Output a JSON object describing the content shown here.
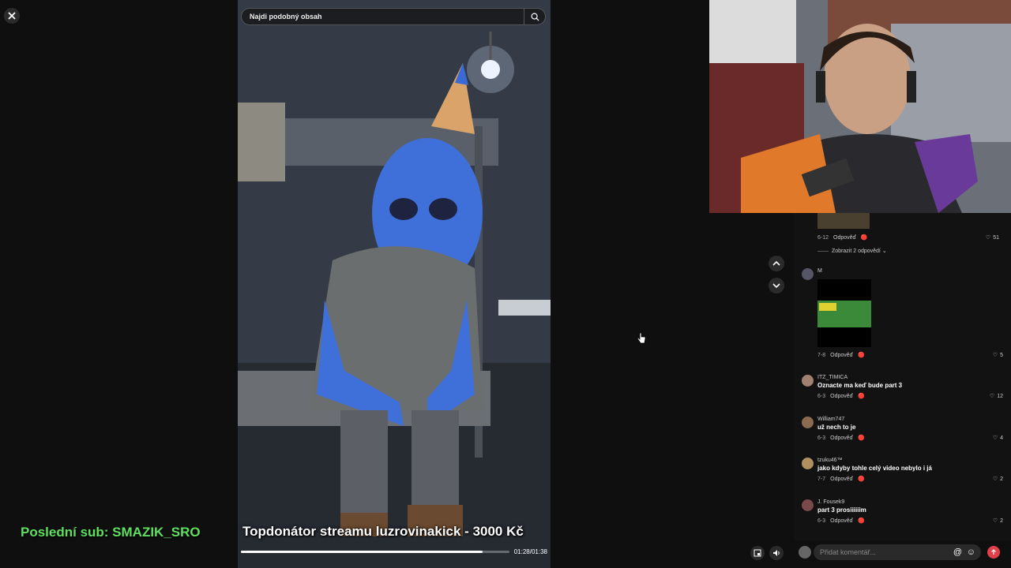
{
  "search": {
    "placeholder": "Najdi podobný obsah"
  },
  "video": {
    "caption": "Topdonátor streamu luzrovinakick - 3000 Kč",
    "time": "01:28/01:38",
    "progress": 0.9
  },
  "overlay": {
    "last_sub": "Poslední sub: SMAZIK_SRO"
  },
  "comments": {
    "top": {
      "date": "6-12",
      "reply": "Odpověď",
      "likes": "51",
      "show_replies": "Zobrazit 2 odpovědí"
    },
    "items": [
      {
        "name": "M",
        "text": "",
        "date": "7-8",
        "reply": "Odpověď",
        "likes": "5"
      },
      {
        "name": "ITZ_TIMICA",
        "text": "Oznacte ma keď bude part 3",
        "date": "6-3",
        "reply": "Odpověď",
        "likes": "12"
      },
      {
        "name": "William747",
        "text": "už nech to je",
        "date": "6-3",
        "reply": "Odpověď",
        "likes": "4"
      },
      {
        "name": "tzuku46™",
        "text": "jako kdyby tohle celý video nebylo i já",
        "date": "7-7",
        "reply": "Odpověď",
        "likes": "2"
      },
      {
        "name": "J. Fousek9",
        "text": "part 3 prosiiiiiim",
        "date": "6-3",
        "reply": "Odpověď",
        "likes": "2"
      }
    ],
    "input_placeholder": "Přidat komentář..."
  },
  "colors": {
    "accent_green": "#5ee05e",
    "send_red": "#e0404a"
  }
}
